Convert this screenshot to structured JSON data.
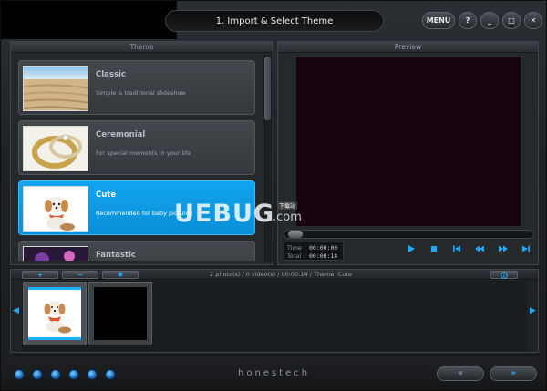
{
  "window": {
    "title": "1. Import & Select Theme",
    "buttons": {
      "menu": "MENU",
      "help": "?",
      "minimize": "_",
      "maximize": "□",
      "close": "✕"
    }
  },
  "theme_panel": {
    "title": "Theme",
    "items": [
      {
        "name": "Classic",
        "desc": "Simple & traditional slideshow",
        "selected": false
      },
      {
        "name": "Ceremonial",
        "desc": "For special moments in your life",
        "selected": false
      },
      {
        "name": "Cute",
        "desc": "Recommended for baby pictures",
        "selected": true
      },
      {
        "name": "Fantastic",
        "desc": "",
        "selected": false
      }
    ]
  },
  "preview_panel": {
    "title": "Preview",
    "time_label": "Time",
    "time_value": "00:00:00",
    "total_label": "Total",
    "total_value": "00:00:14",
    "controls": {
      "play": "play-icon",
      "stop": "stop-icon",
      "first": "skip-back-icon",
      "rewind": "rewind-icon",
      "fast_forward": "fast-forward-icon",
      "last": "skip-forward-icon"
    }
  },
  "storyboard": {
    "add_label": "+",
    "remove_label": "−",
    "effects_label": "✱",
    "status": "2 photo(s) / 0 video(s) / 00:00:14 / Theme: Cute",
    "info_icon": "info-icon",
    "clips": [
      "clip-1",
      "clip-2"
    ]
  },
  "footer": {
    "brand": "honestech",
    "back_label": "«",
    "next_label": "»",
    "step_count": 6
  },
  "watermark": {
    "text": "UEBUG",
    "suffix": ".com",
    "tag": "下载站"
  },
  "colors": {
    "accent": "#0ea0ec",
    "window_bg": "#1f2225",
    "preview_screen": "#19050f"
  }
}
